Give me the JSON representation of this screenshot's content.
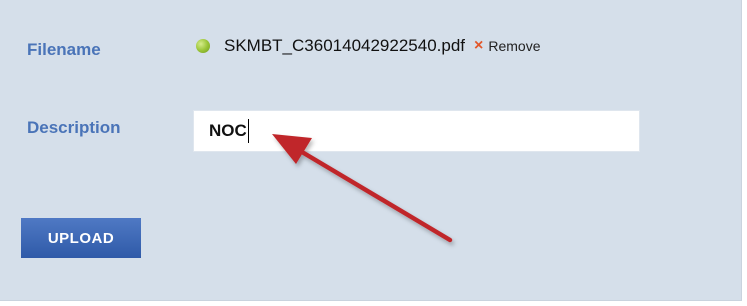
{
  "form": {
    "filename_label": "Filename",
    "description_label": "Description",
    "file": {
      "name": "SKMBT_C36014042922540.pdf",
      "status_icon": "green-dot-icon",
      "status_color": "#9cc63a"
    },
    "remove": {
      "icon": "x-icon",
      "label": "Remove",
      "color": "#e2572a"
    },
    "description_value": "NOC",
    "upload_label": "UPLOAD"
  },
  "colors": {
    "panel_background": "#d5dfea",
    "label_color": "#4a74b8",
    "button_background": "#3a64b2",
    "annotation_arrow": "#c0282a"
  }
}
